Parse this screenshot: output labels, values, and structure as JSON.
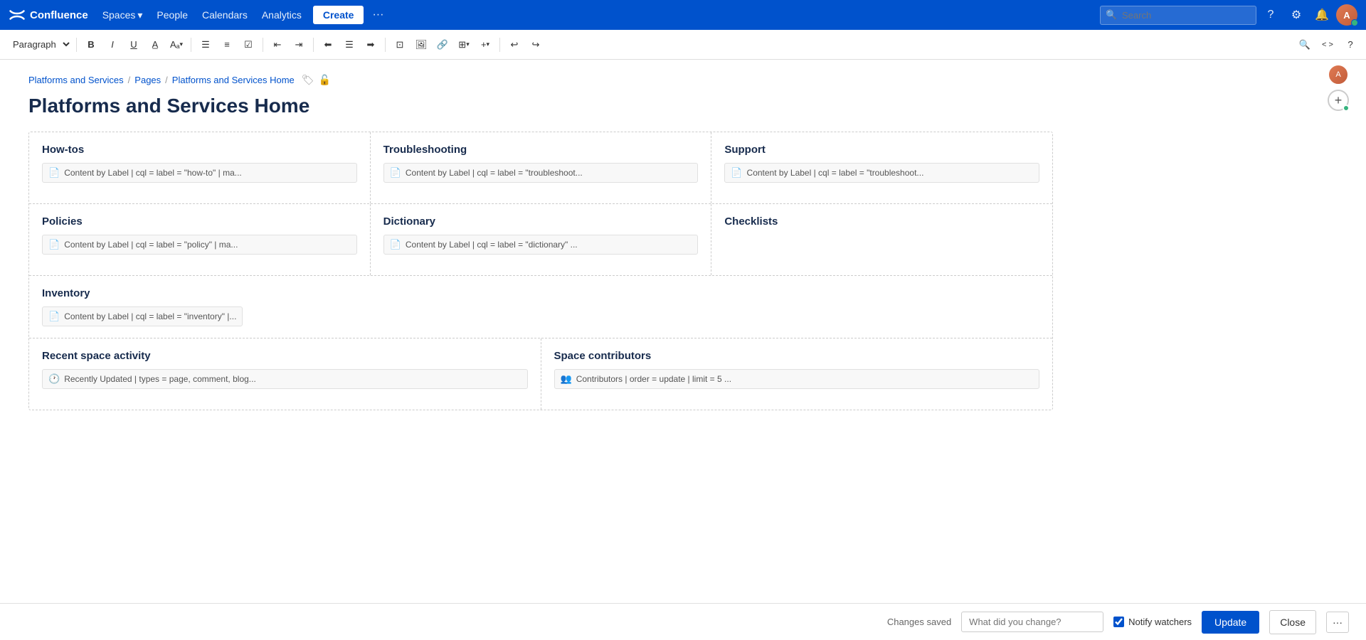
{
  "topnav": {
    "logo_text": "Confluence",
    "spaces_label": "Spaces",
    "people_label": "People",
    "calendars_label": "Calendars",
    "analytics_label": "Analytics",
    "create_label": "Create",
    "more_label": "···",
    "search_placeholder": "Search"
  },
  "toolbar": {
    "paragraph_label": "Paragraph",
    "bold_label": "B",
    "italic_label": "I",
    "underline_label": "U",
    "color_label": "A",
    "format_label": "Aₐ",
    "bullet_list": "☰",
    "numbered_list": "☷",
    "task_list": "☑",
    "indent_left": "⇤",
    "indent_right": "⇥",
    "align_left": "⬅",
    "align_center": "⬛",
    "align_right": "➡",
    "more_formatting": "⋯",
    "insert_image": "🖼",
    "insert_link": "🔗",
    "insert_table": "⊞",
    "insert_plus": "+",
    "undo": "↩",
    "redo": "↪"
  },
  "breadcrumb": {
    "space": "Platforms and Services",
    "pages": "Pages",
    "current": "Platforms and Services Home"
  },
  "page": {
    "title": "Platforms and Services Home"
  },
  "sections": [
    {
      "id": "row1",
      "cells": [
        {
          "id": "how-tos",
          "title": "How-tos",
          "macro": "Content by Label | cql = label = \"how-to\" | ma..."
        },
        {
          "id": "troubleshooting",
          "title": "Troubleshooting",
          "macro": "Content by Label | cql = label = \"troubleshoot..."
        },
        {
          "id": "support",
          "title": "Support",
          "macro": "Content by Label | cql = label = \"troubleshoot..."
        }
      ]
    },
    {
      "id": "row2",
      "cells": [
        {
          "id": "policies",
          "title": "Policies",
          "macro": "Content by Label | cql = label = \"policy\" | ma..."
        },
        {
          "id": "dictionary",
          "title": "Dictionary",
          "macro": "Content by Label | cql = label = \"dictionary\" ..."
        },
        {
          "id": "checklists",
          "title": "Checklists",
          "macro": null
        }
      ]
    },
    {
      "id": "row3",
      "cells": [
        {
          "id": "inventory",
          "title": "Inventory",
          "macro": "Content by Label | cql = label = \"inventory\" |...",
          "full_width": true
        }
      ]
    },
    {
      "id": "row4",
      "cells": [
        {
          "id": "recent-space-activity",
          "title": "Recent space activity",
          "macro": "Recently Updated | types = page, comment, blog..."
        },
        {
          "id": "space-contributors",
          "title": "Space contributors",
          "macro": "Contributors | order = update | limit = 5 ..."
        }
      ]
    }
  ],
  "bottom_bar": {
    "changes_saved": "Changes saved",
    "change_placeholder": "What did you change?",
    "notify_label": "Notify watchers",
    "update_label": "Update",
    "close_label": "Close",
    "more_label": "···"
  }
}
